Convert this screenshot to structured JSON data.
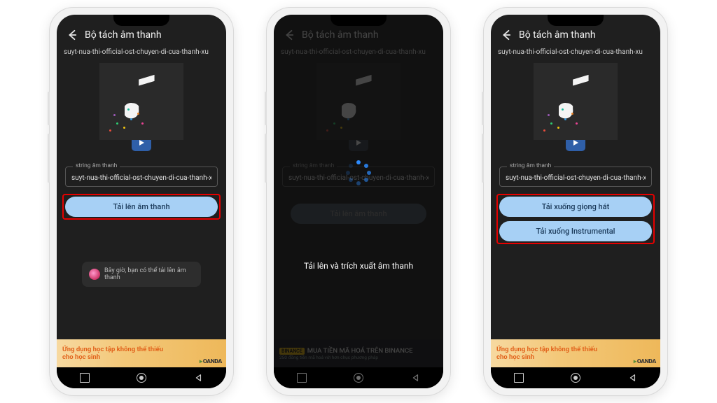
{
  "header": {
    "title": "Bộ tách âm thanh"
  },
  "filename": "suyt-nua-thi-official-ost-chuyen-di-cua-thanh-xu",
  "field": {
    "legend": "string âm thanh",
    "value": "suyt-nua-thi-official-ost-chuyen-di-cua-thanh-xu"
  },
  "buttons": {
    "upload": "Tải lên âm thanh",
    "download_vocal": "Tải xuống giọng hát",
    "download_instrumental": "Tải xuống Instrumental"
  },
  "hint": "Bây giờ, bạn có thể tải lên âm thanh",
  "loading_text": "Tải lên và trích xuất âm thanh",
  "ads": {
    "oanda_line1": "Ứng dụng học tập không thể thiếu",
    "oanda_line2": "cho học sinh",
    "oanda_brand": "OANDA",
    "binance_title": "MUA TIỀN MÃ HOÁ TRÊN BINANCE",
    "binance_sub": "250 đồng tiền mã hoá với hơn chục phương pháp",
    "binance_tag": "BINANCE"
  }
}
